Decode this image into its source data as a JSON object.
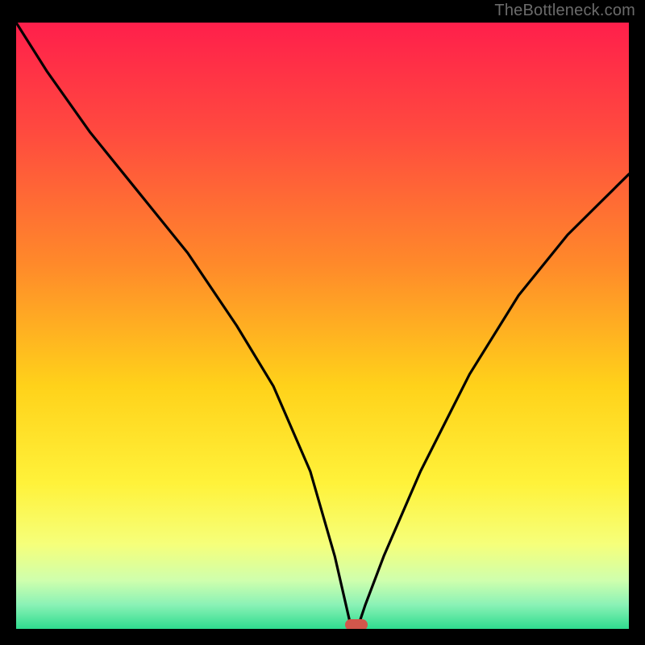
{
  "watermark": "TheBottleneck.com",
  "chart_data": {
    "type": "line",
    "title": "",
    "xlabel": "",
    "ylabel": "",
    "xlim": [
      0,
      100
    ],
    "ylim": [
      0,
      100
    ],
    "series": [
      {
        "name": "bottleneck-curve",
        "x": [
          0,
          5,
          12,
          20,
          28,
          36,
          42,
          48,
          52,
          54.5,
          55,
          56,
          57,
          60,
          66,
          74,
          82,
          90,
          100
        ],
        "values": [
          100,
          92,
          82,
          72,
          62,
          50,
          40,
          26,
          12,
          1,
          0,
          1,
          4,
          12,
          26,
          42,
          55,
          65,
          75
        ]
      }
    ],
    "marker": {
      "x": 55.5,
      "y": 0.7
    },
    "gradient_stops": [
      {
        "offset": 0,
        "color": "#ff1f4b"
      },
      {
        "offset": 18,
        "color": "#ff4a3f"
      },
      {
        "offset": 40,
        "color": "#ff8a2a"
      },
      {
        "offset": 60,
        "color": "#ffd21a"
      },
      {
        "offset": 76,
        "color": "#fff23a"
      },
      {
        "offset": 86,
        "color": "#f6ff7a"
      },
      {
        "offset": 92,
        "color": "#cfffad"
      },
      {
        "offset": 96,
        "color": "#8bf2b6"
      },
      {
        "offset": 100,
        "color": "#2fdc8f"
      }
    ]
  }
}
